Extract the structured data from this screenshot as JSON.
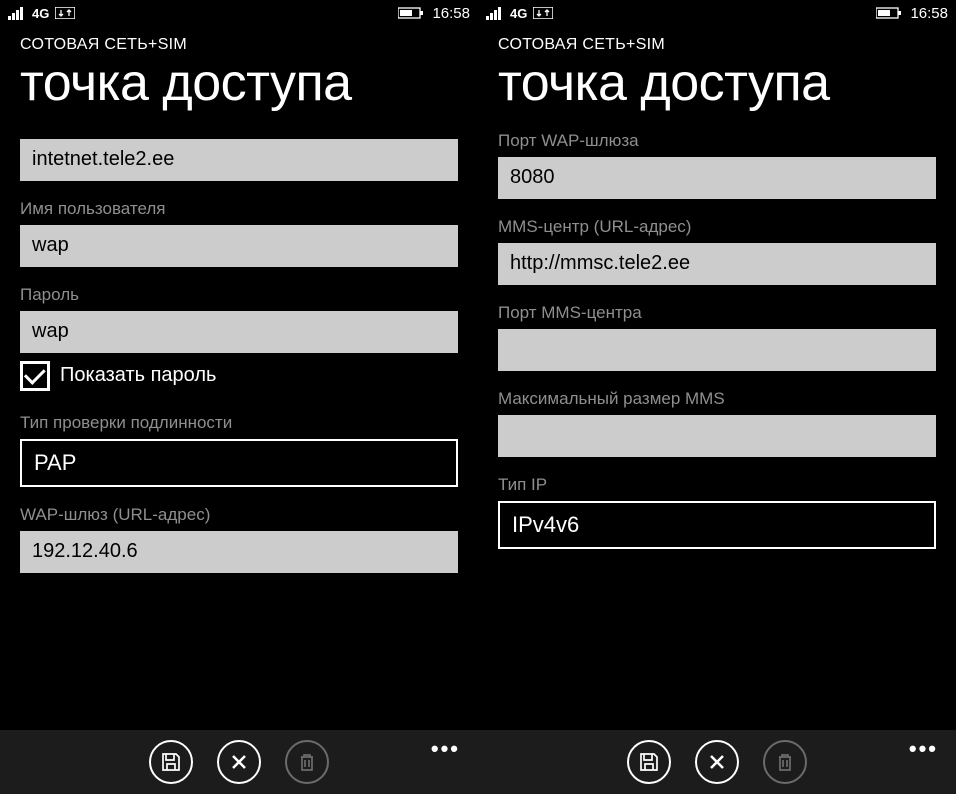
{
  "screens": [
    {
      "status": {
        "network": "4G",
        "time": "16:58"
      },
      "breadcrumb": "СОТОВАЯ СЕТЬ+SIM",
      "title": "точка доступа",
      "fields": {
        "apn": {
          "value": "intetnet.tele2.ee"
        },
        "username": {
          "label": "Имя пользователя",
          "value": "wap"
        },
        "password": {
          "label": "Пароль",
          "value": "wap"
        },
        "showPassword": {
          "label": "Показать пароль",
          "checked": true
        },
        "authType": {
          "label": "Тип проверки подлинности",
          "value": "PAP"
        },
        "wapGateway": {
          "label": "WAP-шлюз (URL-адрес)",
          "value": "192.12.40.6"
        }
      }
    },
    {
      "status": {
        "network": "4G",
        "time": "16:58"
      },
      "breadcrumb": "СОТОВАЯ СЕТЬ+SIM",
      "title": "точка доступа",
      "fields": {
        "wapPort": {
          "label": "Порт WAP-шлюза",
          "value": "8080"
        },
        "mmsCenter": {
          "label": "MMS-центр (URL-адрес)",
          "value": "http://mmsc.tele2.ee"
        },
        "mmsPort": {
          "label": "Порт MMS-центра",
          "value": ""
        },
        "mmsMaxSize": {
          "label": "Максимальный размер MMS",
          "value": ""
        },
        "ipType": {
          "label": "Тип IP",
          "value": "IPv4v6"
        }
      }
    }
  ],
  "appBar": {
    "more": "•••"
  }
}
